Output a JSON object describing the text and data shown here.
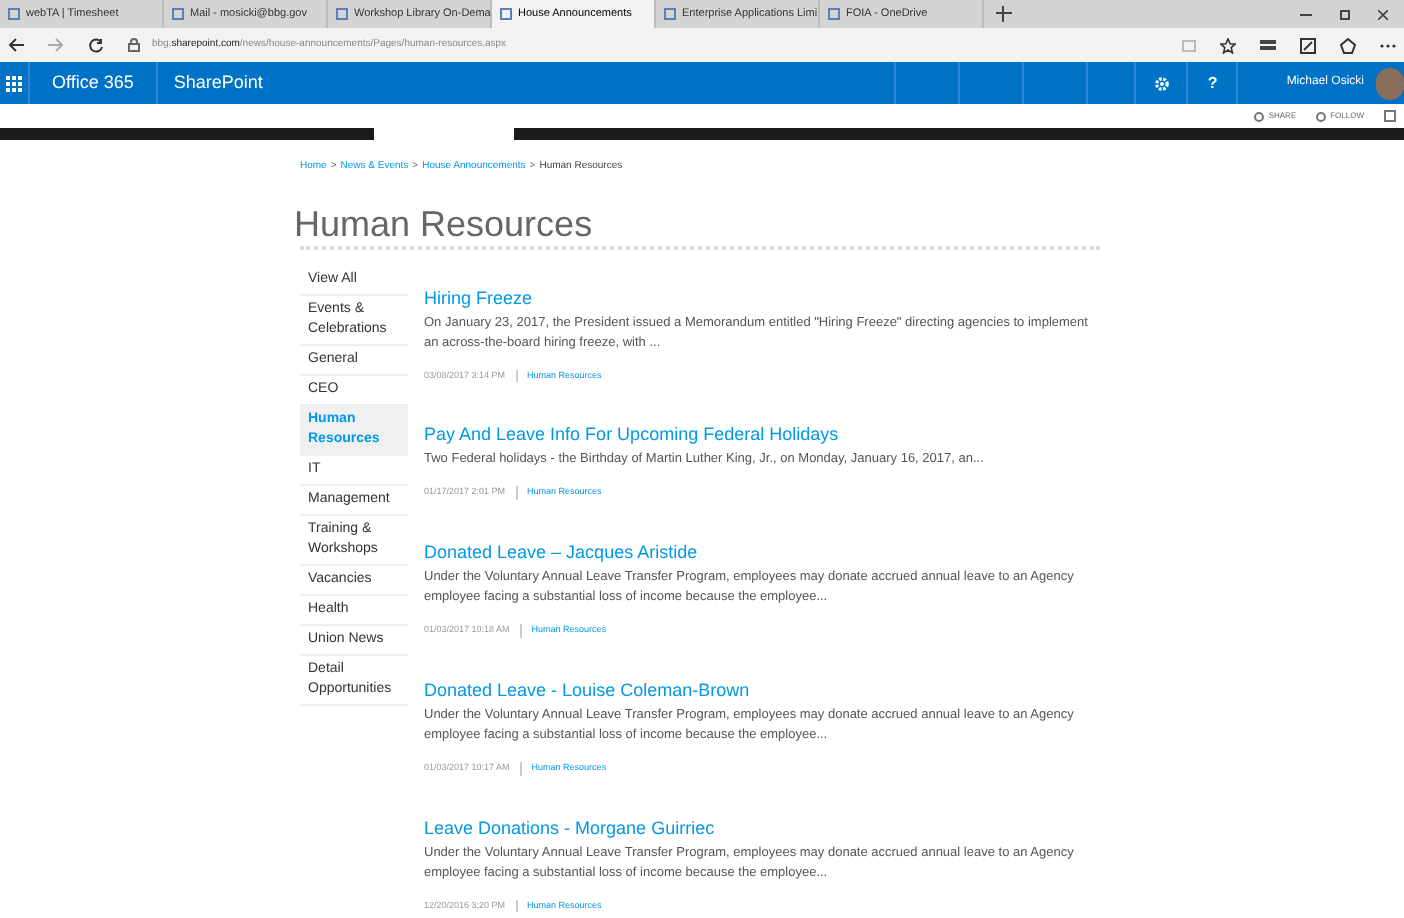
{
  "browser_tabs": [
    {
      "title": "webTA | Timesheet",
      "selected": false
    },
    {
      "title": "Mail - mosicki@bbg.gov",
      "selected": false
    },
    {
      "title": "Workshop Library On-Dema",
      "selected": false
    },
    {
      "title": "House Announcements",
      "selected": true
    },
    {
      "title": "Enterprise Applications Limi",
      "selected": false
    },
    {
      "title": "FOIA - OneDrive",
      "selected": false
    }
  ],
  "address_bar": {
    "host_prefix": "bbg.",
    "domain": "sharepoint.com",
    "path": "/news/house-announcements/Pages/human-resources.aspx"
  },
  "suite_bar": {
    "app": "Office 365",
    "site": "SharePoint",
    "help": "?",
    "user": "Michael Osicki"
  },
  "actions": [
    {
      "label": "SHARE"
    },
    {
      "label": "FOLLOW"
    }
  ],
  "breadcrumb": {
    "separator": ">",
    "links": [
      "Home",
      "News & Events",
      "House Announcements"
    ],
    "current": "Human Resources"
  },
  "page_title": "Human Resources",
  "sidebar": {
    "items": [
      {
        "label": "View All",
        "selected": false
      },
      {
        "label": "Events & Celebrations",
        "selected": false
      },
      {
        "label": "General",
        "selected": false
      },
      {
        "label": "CEO",
        "selected": false
      },
      {
        "label": "Human Resources",
        "selected": true
      },
      {
        "label": "IT",
        "selected": false
      },
      {
        "label": "Management",
        "selected": false
      },
      {
        "label": "Training & Workshops",
        "selected": false
      },
      {
        "label": "Vacancies",
        "selected": false
      },
      {
        "label": "Health",
        "selected": false
      },
      {
        "label": "Union News",
        "selected": false
      },
      {
        "label": "Detail Opportunities",
        "selected": false
      }
    ]
  },
  "articles": [
    {
      "title": "Hiring Freeze",
      "summary": "On January 23, 2017, the President issued a Memorandum entitled \"Hiring Freeze\" directing agencies to implement an across-the-board hiring freeze, with ...",
      "date": "03/08/2017 3:14 PM",
      "category": "Human Resources"
    },
    {
      "title": "Pay And Leave Info For Upcoming Federal Holidays",
      "summary": "Two Federal holidays - the Birthday of Martin Luther King, Jr., on Monday, January 16, 2017, an...",
      "date": "01/17/2017 2:01 PM",
      "category": "Human Resources"
    },
    {
      "title": "Donated Leave – Jacques Aristide",
      "summary": "Under the Voluntary Annual Leave Transfer Program, employees may donate accrued annual leave to an Agency employee facing a substantial loss of income because the employee...",
      "date": "01/03/2017 10:18 AM",
      "category": "Human Resources"
    },
    {
      "title": "Donated Leave - Louise Coleman-Brown",
      "summary": "Under the Voluntary Annual Leave Transfer Program, employees may donate accrued annual leave to an Agency employee facing a substantial loss of income because the employee...",
      "date": "01/03/2017 10:17 AM",
      "category": "Human Resources"
    },
    {
      "title": "Leave Donations - Morgane Guirriec",
      "summary": "Under the Voluntary Annual Leave Transfer Program, employees may donate accrued annual leave to an Agency employee facing a substantial loss of income because the employee...",
      "date": "12/20/2016 3:20 PM",
      "category": "Human Resources"
    }
  ]
}
